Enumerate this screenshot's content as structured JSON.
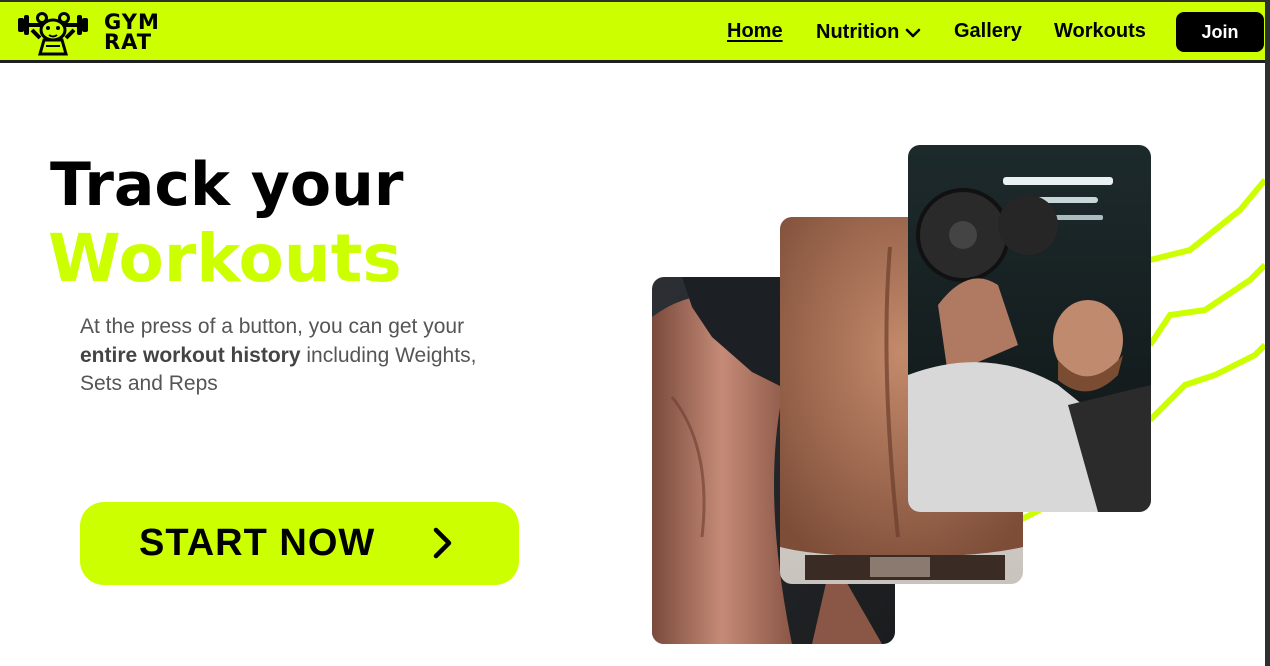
{
  "brand": {
    "name_line1": "GYM",
    "name_line2": "RAT",
    "logo_icon": "barbell-rat-icon"
  },
  "nav": {
    "home": "Home",
    "nutrition": "Nutrition",
    "gallery": "Gallery",
    "workouts": "Workouts",
    "join": "Join"
  },
  "hero": {
    "title_line1": "Track your",
    "title_line2": "Workouts",
    "desc_part1": "At the press of a button, you can get your ",
    "desc_bold": "entire workout history",
    "desc_part2": " including Weights, Sets and Reps",
    "cta_label": "START NOW"
  },
  "images": [
    {
      "name": "legs-photo"
    },
    {
      "name": "back-photo"
    },
    {
      "name": "bench-press-photo"
    }
  ],
  "colors": {
    "accent": "#ccff00",
    "dark": "#000000",
    "text_gray": "#555555"
  }
}
